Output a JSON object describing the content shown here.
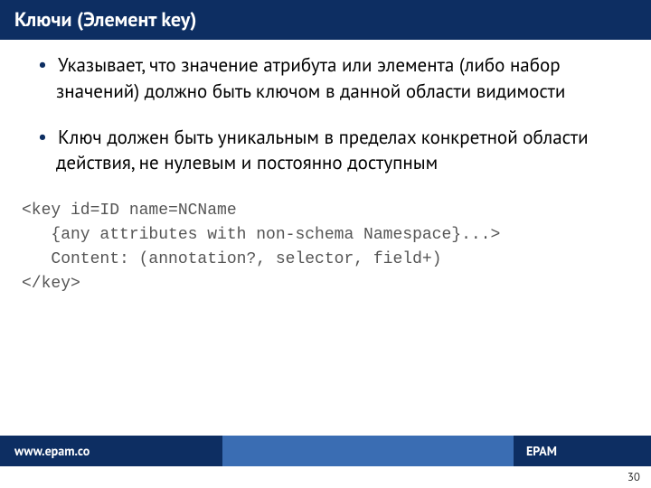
{
  "title": "Ключи (Элемент key)",
  "bullets": [
    "Указывает, что значение атрибута или элемента (либо набор значений) должно быть ключом в данной области видимости",
    "Ключ должен быть уникальным в пределах конкретной области действия, не нулевым и постоянно доступным"
  ],
  "code": "<key id=ID name=NCName\n   {any attributes with non-schema Namespace}...>\n   Content: (annotation?, selector, field+)\n</key>",
  "footer": {
    "url": "www.epam.co",
    "brand": "EPAM"
  },
  "page_number": "30"
}
